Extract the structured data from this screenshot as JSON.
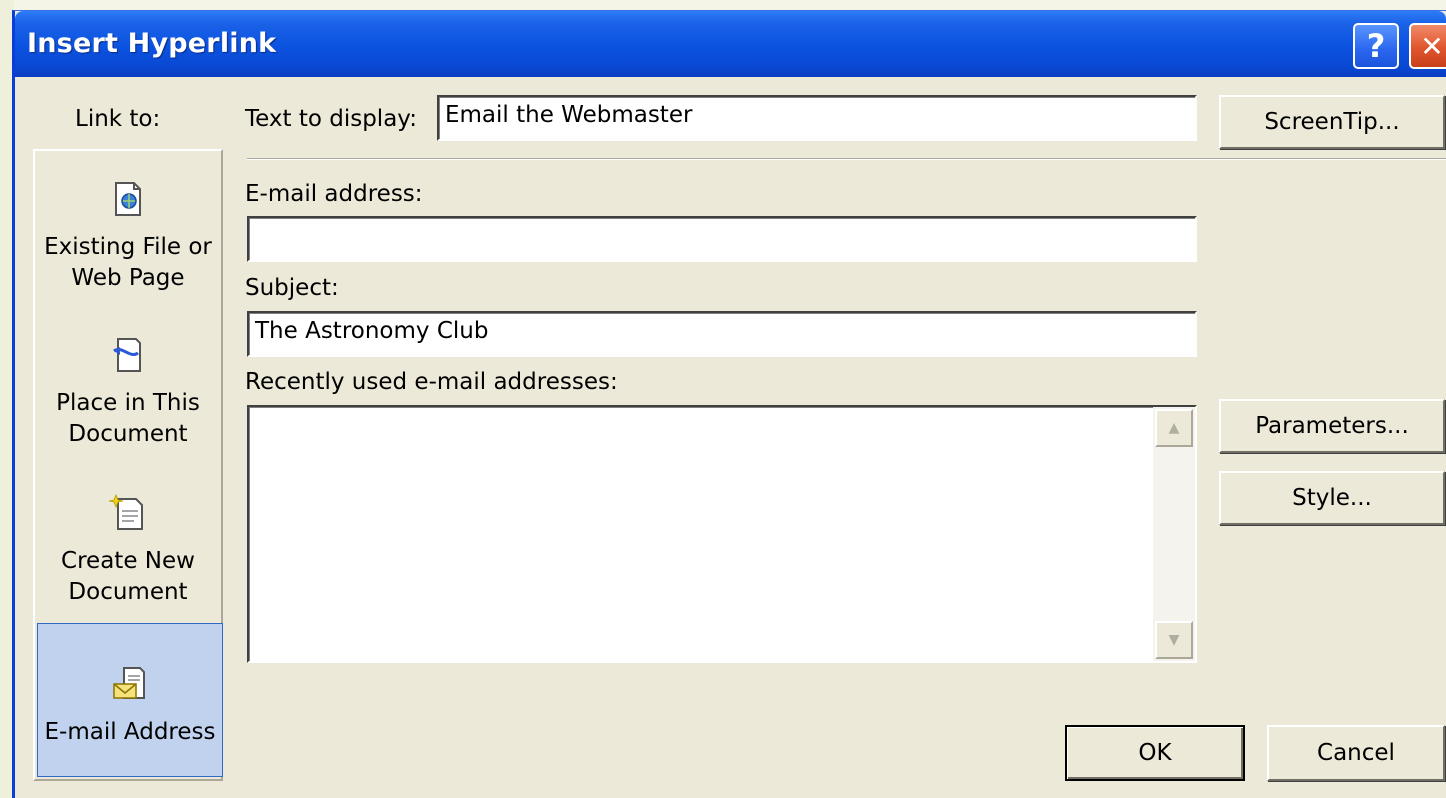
{
  "window": {
    "title": "Insert Hyperlink",
    "help_symbol": "?",
    "close_symbol": "✕"
  },
  "link_to": {
    "label": "Link to:",
    "items": [
      {
        "line1": "Existing File or",
        "line2": "Web Page",
        "icon": "web-page-icon"
      },
      {
        "line1": "Place in This",
        "line2": "Document",
        "icon": "bookmark-page-icon"
      },
      {
        "line1": "Create New",
        "line2": "Document",
        "icon": "new-document-icon"
      },
      {
        "line1": "E-mail Address",
        "line2": "",
        "icon": "email-envelope-icon",
        "selected": true
      }
    ]
  },
  "form": {
    "text_to_display_label": "Text to display:",
    "text_to_display_value": "Email the Webmaster",
    "email_address_label": "E-mail address:",
    "email_address_value": "",
    "subject_label": "Subject:",
    "subject_value": "The Astronomy Club",
    "recent_label": "Recently used e-mail addresses:",
    "recent_items": []
  },
  "buttons": {
    "screentip": "ScreenTip...",
    "parameters": "Parameters...",
    "style": "Style...",
    "ok": "OK",
    "cancel": "Cancel"
  },
  "colors": {
    "titlebar": "#0b52e0",
    "selected_item_bg": "#c1d2ee",
    "selected_item_border": "#316ac5",
    "dialog_bg": "#ece9d8",
    "close_button": "#e0552c"
  }
}
